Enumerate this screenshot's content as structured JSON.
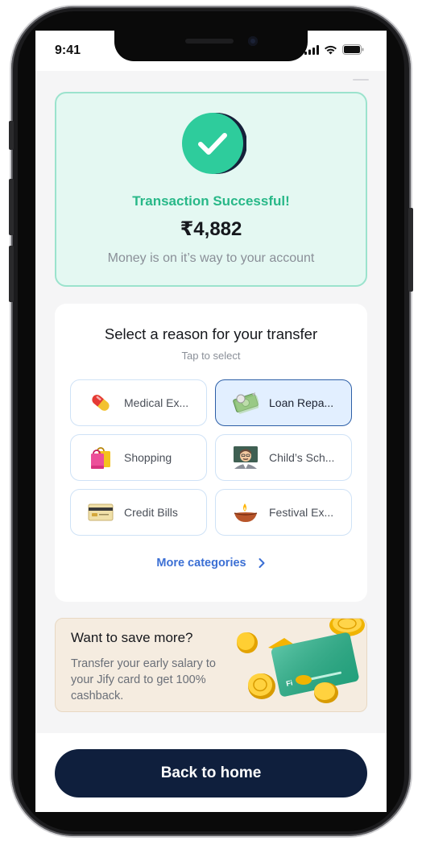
{
  "status_bar": {
    "time": "9:41"
  },
  "success": {
    "title": "Transaction Successful!",
    "amount": "₹4,882",
    "subtitle": "Money is on it’s way to your account",
    "accent_color": "#28b888"
  },
  "reason": {
    "title": "Select a reason for your transfer",
    "subtitle": "Tap to select",
    "chips": [
      {
        "label": "Medical Ex...",
        "icon": "pill-icon",
        "selected": false
      },
      {
        "label": "Loan Repa...",
        "icon": "money-icon",
        "selected": true
      },
      {
        "label": "Shopping",
        "icon": "shopping-bags-icon",
        "selected": false
      },
      {
        "label": "Child’s Sch...",
        "icon": "teacher-icon",
        "selected": false
      },
      {
        "label": "Credit Bills",
        "icon": "credit-card-icon",
        "selected": false
      },
      {
        "label": "Festival Ex...",
        "icon": "diya-lamp-icon",
        "selected": false
      }
    ],
    "more_label": "More categories"
  },
  "promo": {
    "title": "Want to save more?",
    "text": "Transfer your early salary to your Jify card to get 100% cashback."
  },
  "footer": {
    "button_label": "Back to home",
    "button_color": "#0f1f3d"
  }
}
